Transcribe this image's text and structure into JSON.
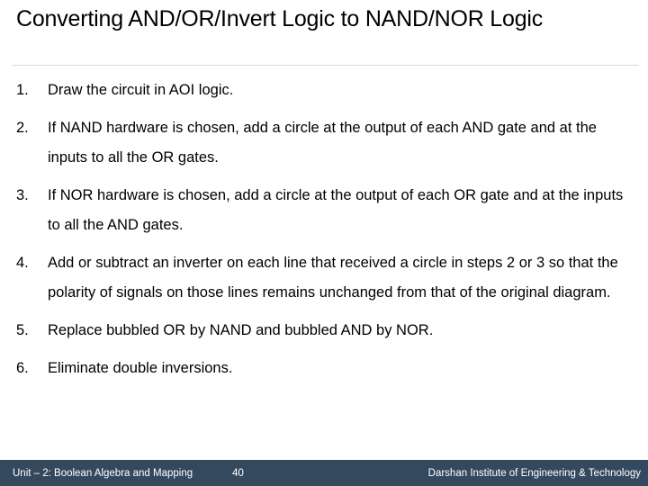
{
  "slide": {
    "title": "Converting AND/OR/Invert Logic to NAND/NOR Logic",
    "background_color": "#FFFFFF",
    "text_color": "#000000",
    "divider_color": "#D9D9D9"
  },
  "body": {
    "items": [
      {
        "marker": "1.",
        "text": "Draw the circuit in AOI logic."
      },
      {
        "marker": "2.",
        "text": "If NAND hardware is chosen, add a circle at the output of each AND gate and at the inputs to all the OR gates."
      },
      {
        "marker": "3.",
        "text": "If NOR hardware is chosen, add a circle at the output of each OR gate and at the inputs to all the AND gates."
      },
      {
        "marker": "4.",
        "text": "Add or subtract an inverter on each line that received a circle in steps 2 or 3 so that the polarity of signals on those lines remains unchanged from that of the original diagram."
      },
      {
        "marker": "5.",
        "text": "Replace bubbled OR by NAND and bubbled AND by NOR."
      },
      {
        "marker": "6.",
        "text": "Eliminate double inversions."
      }
    ]
  },
  "footer": {
    "unit_label": "Unit – 2: Boolean Algebra and Mapping",
    "page_number": "40",
    "institute": "Darshan Institute of Engineering & Technology",
    "background_color": "#35495E",
    "text_color": "#FFFFFF"
  }
}
